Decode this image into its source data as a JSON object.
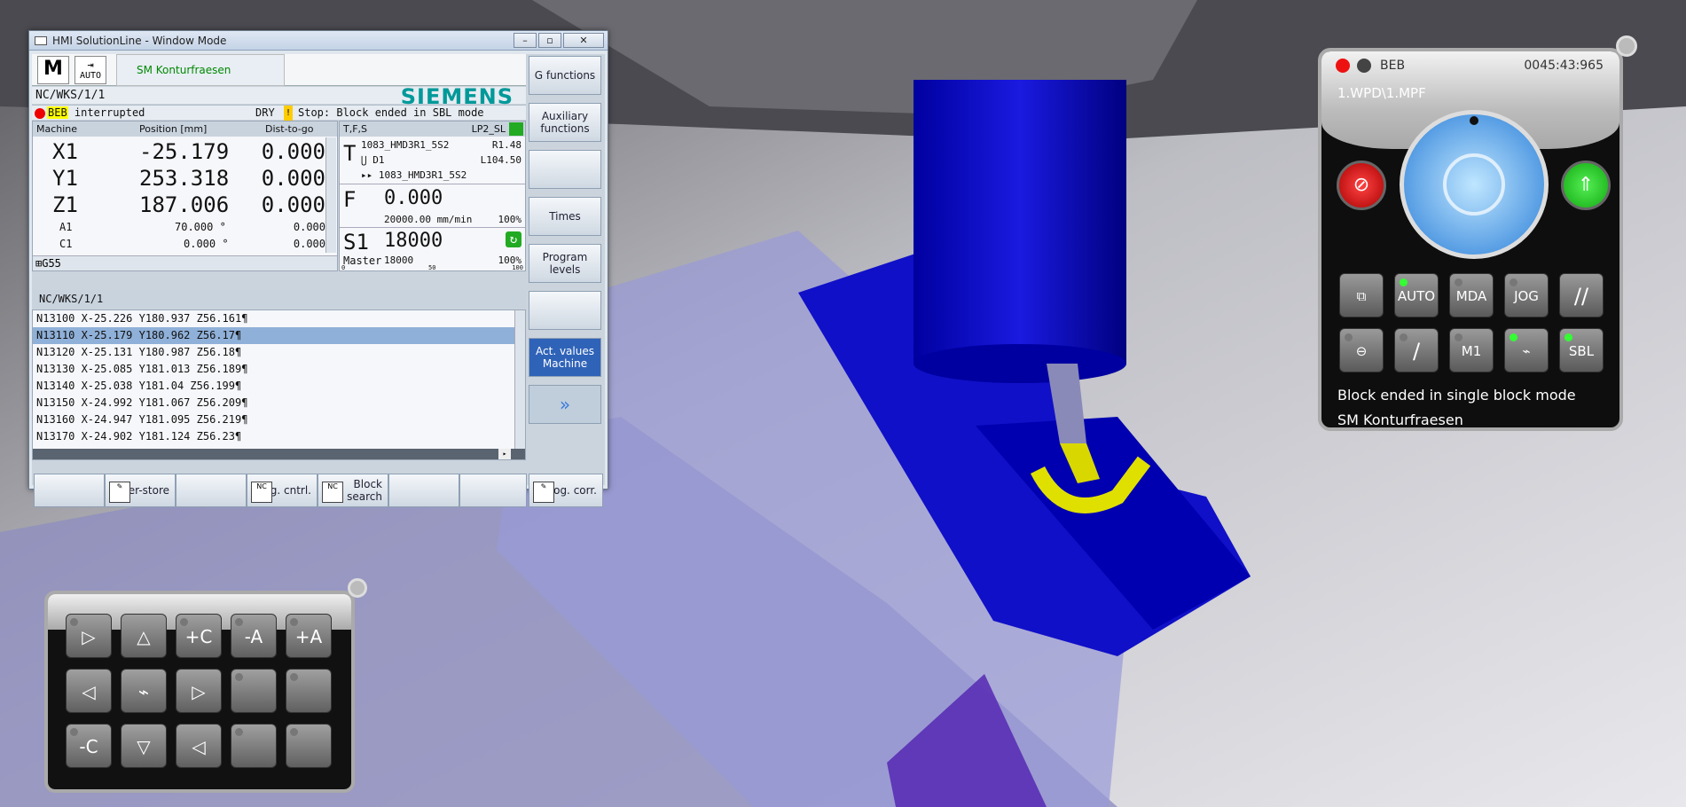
{
  "window": {
    "title": "HMI SolutionLine - Window Mode",
    "minimize": "–",
    "maximize": "▫",
    "close": "✕"
  },
  "header": {
    "mode_label": "AUTO",
    "program_name": "SM Konturfraesen",
    "brand": "SIEMENS",
    "brand_color": "#009999"
  },
  "channel": "NC/WKS/1/1",
  "status": {
    "beb": "BEB",
    "state": "interrupted",
    "dry": "DRY",
    "message": "Stop: Block ended in SBL mode"
  },
  "axes": {
    "headers": [
      "Machine",
      "Position [mm]",
      "Dist-to-go"
    ],
    "rows": [
      {
        "name": "X1",
        "pos": "-25.179",
        "dtg": "0.000"
      },
      {
        "name": "Y1",
        "pos": "253.318",
        "dtg": "0.000"
      },
      {
        "name": "Z1",
        "pos": "187.006",
        "dtg": "0.000"
      },
      {
        "name": "A1",
        "pos": "70.000 °",
        "dtg": "0.000"
      },
      {
        "name": "C1",
        "pos": "0.000 °",
        "dtg": "0.000"
      }
    ],
    "frame": "G55"
  },
  "tfs": {
    "header": "T,F,S",
    "tool_pos": "LP2_SL",
    "t_label": "T",
    "tool": "1083_HMD3R1_5S2",
    "radius": "R1.48",
    "d": "D1",
    "length": "L104.50",
    "next_tool": "▸▸ 1083_HMD3R1_5S2",
    "f_label": "F",
    "feed": "0.000",
    "feed_max": "20000.00 mm/min",
    "feed_ovr": "100%",
    "s_label": "S1",
    "speed": "18000",
    "spindle_mode": "Master",
    "spindle_set": "18000",
    "spindle_ovr": "100%",
    "scale": [
      "0",
      "50",
      "100"
    ]
  },
  "program": {
    "header": "NC/WKS/1/1",
    "lines": [
      "N13100 X-25.226 Y180.937 Z56.161¶",
      "N13110 X-25.179 Y180.962 Z56.17¶",
      "N13120 X-25.131 Y180.987 Z56.18¶",
      "N13130 X-25.085 Y181.013 Z56.189¶",
      "N13140 X-25.038 Y181.04 Z56.199¶",
      "N13150 X-24.992 Y181.067 Z56.209¶",
      "N13160 X-24.947 Y181.095 Z56.219¶",
      "N13170 X-24.902 Y181.124 Z56.23¶"
    ],
    "selected_index": 1
  },
  "vsoftkeys": [
    "G functions",
    "Auxiliary functions",
    "",
    "Times",
    "Program levels",
    "",
    "Act. values Machine",
    "»"
  ],
  "hsoftkeys": [
    "",
    "Over-store",
    "",
    "Prog. cntrl.",
    "Block search",
    "",
    "",
    "Prog. corr."
  ],
  "op_panel": {
    "beb": "BEB",
    "time": "0045:43:965",
    "file": "1.WPD\\1.MPF",
    "buttons_row1": [
      "",
      "AUTO",
      "MDA",
      "JOG",
      "//"
    ],
    "buttons_row2": [
      "",
      "/",
      "M1",
      "",
      "SBL"
    ],
    "message1": "Block ended in single block mode",
    "message2": "SM Konturfraesen"
  },
  "keypad": {
    "row1": [
      "▷",
      "△",
      "+C",
      "-A",
      "+A"
    ],
    "row2": [
      "◁",
      "",
      "▷",
      "",
      ""
    ],
    "row3": [
      "-C",
      "▽",
      "◁",
      "",
      ""
    ]
  }
}
